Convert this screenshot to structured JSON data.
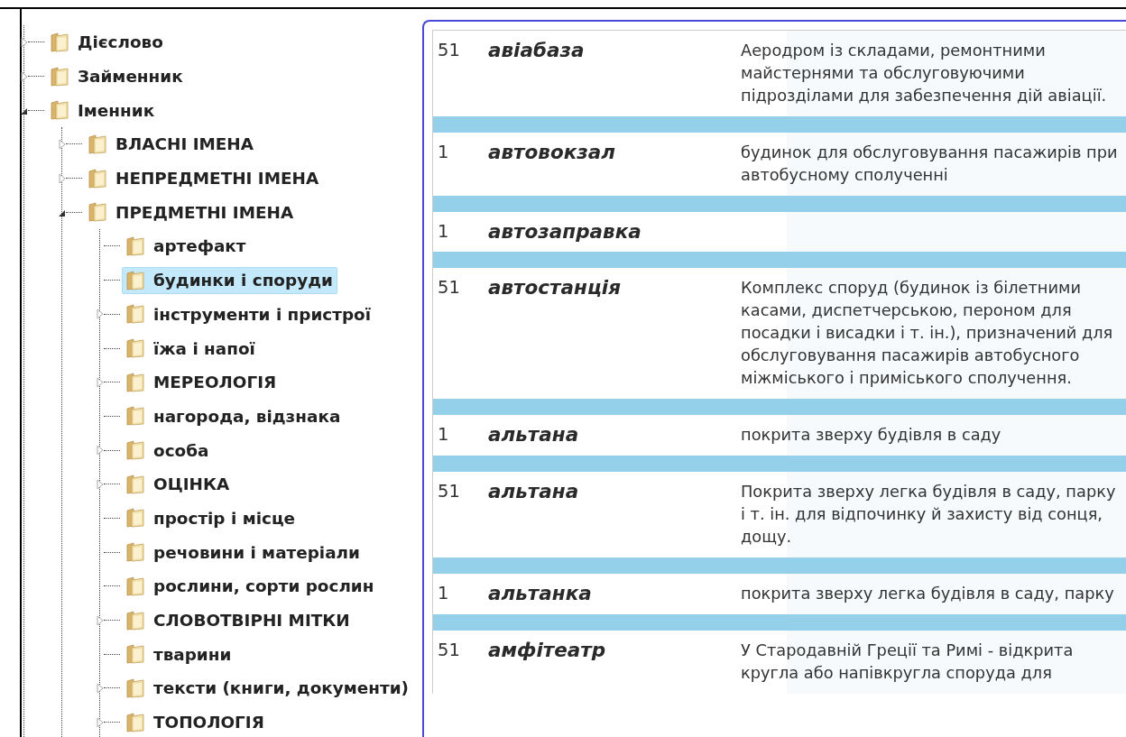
{
  "tree": [
    {
      "label": "Дієслово",
      "kind": "branch",
      "expanded": false,
      "selected": false
    },
    {
      "label": "Займенник",
      "kind": "branch",
      "expanded": false,
      "selected": false
    },
    {
      "label": "Іменник",
      "kind": "branch",
      "expanded": true,
      "selected": false,
      "children": [
        {
          "label": "ВЛАСНІ ІМЕНА",
          "kind": "branch",
          "expanded": false,
          "selected": false
        },
        {
          "label": "НЕПРЕДМЕТНІ ІМЕНА",
          "kind": "branch",
          "expanded": false,
          "selected": false
        },
        {
          "label": "ПРЕДМЕТНІ ІМЕНА",
          "kind": "branch",
          "expanded": true,
          "selected": false,
          "children": [
            {
              "label": "артефакт",
              "kind": "leaf",
              "selected": false
            },
            {
              "label": "будинки і споруди",
              "kind": "leaf",
              "selected": true
            },
            {
              "label": "інструменти і пристрої",
              "kind": "branch",
              "expanded": false,
              "selected": false
            },
            {
              "label": "їжа і напої",
              "kind": "leaf",
              "selected": false
            },
            {
              "label": "МЕРЕОЛОГІЯ",
              "kind": "branch",
              "expanded": false,
              "selected": false
            },
            {
              "label": "нагорода, відзнака",
              "kind": "leaf",
              "selected": false
            },
            {
              "label": "особа",
              "kind": "branch",
              "expanded": false,
              "selected": false
            },
            {
              "label": "ОЦІНКА",
              "kind": "branch",
              "expanded": false,
              "selected": false
            },
            {
              "label": "простір і місце",
              "kind": "leaf",
              "selected": false
            },
            {
              "label": "речовини і матеріали",
              "kind": "leaf",
              "selected": false
            },
            {
              "label": "рослини, сорти рослин",
              "kind": "leaf",
              "selected": false
            },
            {
              "label": "СЛОВОТВІРНІ МІТКИ",
              "kind": "branch",
              "expanded": false,
              "selected": false
            },
            {
              "label": "тварини",
              "kind": "leaf",
              "selected": false
            },
            {
              "label": "тексти (книги, документи)",
              "kind": "branch",
              "expanded": false,
              "selected": false
            },
            {
              "label": "ТОПОЛОГІЯ",
              "kind": "branch",
              "expanded": false,
              "selected": false
            }
          ]
        }
      ]
    }
  ],
  "entries": [
    {
      "number": "51",
      "word": "авіабаза",
      "definition": "Аеродром із складами, ремонтними майстернями та обслуговуючими підрозділами для забезпечення дій авіації."
    },
    {
      "number": "1",
      "word": "автовокзал",
      "definition": "будинок для обслуговування пасажирів при автобусному сполученні"
    },
    {
      "number": "1",
      "word": "автозаправка"
    },
    {
      "number": "51",
      "word": "автостанція",
      "definition": "Комплекс споруд (будинок із білетними касами, диспетчерською, пероном для посадки і висадки і т. ін.), призначений для обслуговування пасажирів автобусного міжміського і приміського сполучення."
    },
    {
      "number": "1",
      "word": "альтана",
      "definition": "покрита зверху будівля в саду"
    },
    {
      "number": "51",
      "word": "альтана",
      "definition": "Покрита зверху легка будівля в саду, парку і т. ін. для відпочинку й захисту від сонця, дощу."
    },
    {
      "number": "1",
      "word": "альтанка",
      "definition": "покрита зверху легка будівля в саду, парку"
    },
    {
      "number": "51",
      "word": "амфітеатр",
      "definition": "У Стародавній Греції та Римі - відкрита кругла або напівкругла споруда для"
    }
  ]
}
